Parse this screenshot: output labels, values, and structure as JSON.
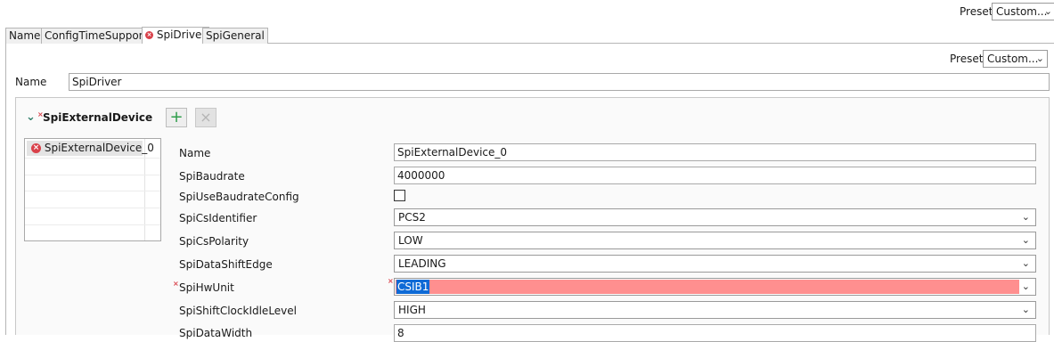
{
  "preset_top": {
    "label": "Preset",
    "value": "Custom..."
  },
  "tabs": [
    {
      "label": "Name"
    },
    {
      "label": "ConfigTimeSupport"
    },
    {
      "label": "SpiDriver"
    },
    {
      "label": "SpiGeneral"
    }
  ],
  "panel": {
    "preset_label": "Preset",
    "preset_value": "Custom...",
    "name_label": "Name",
    "name_value": "SpiDriver"
  },
  "section": {
    "title": "SpiExternalDevice",
    "add_label": "+",
    "remove_label": "×"
  },
  "device_list": {
    "items": [
      "SpiExternalDevice_0"
    ]
  },
  "form": {
    "name": {
      "label": "Name",
      "value": "SpiExternalDevice_0"
    },
    "baudrate": {
      "label": "SpiBaudrate",
      "value": "4000000"
    },
    "use_baudrate_config": {
      "label": "SpiUseBaudrateConfig",
      "checked": false
    },
    "cs_identifier": {
      "label": "SpiCsIdentifier",
      "value": "PCS2"
    },
    "cs_polarity": {
      "label": "SpiCsPolarity",
      "value": "LOW"
    },
    "data_shift_edge": {
      "label": "SpiDataShiftEdge",
      "value": "LEADING"
    },
    "hw_unit": {
      "label": "SpiHwUnit",
      "value": "CSIB1"
    },
    "shift_clock_idle": {
      "label": "SpiShiftClockIdleLevel",
      "value": "HIGH"
    },
    "data_width": {
      "label": "SpiDataWidth",
      "value": "8"
    }
  },
  "colors": {
    "error_red": "#d9414a",
    "error_field": "#ff8f8f",
    "selection_blue": "#0e6ad6",
    "add_green": "#2e9d4a"
  }
}
